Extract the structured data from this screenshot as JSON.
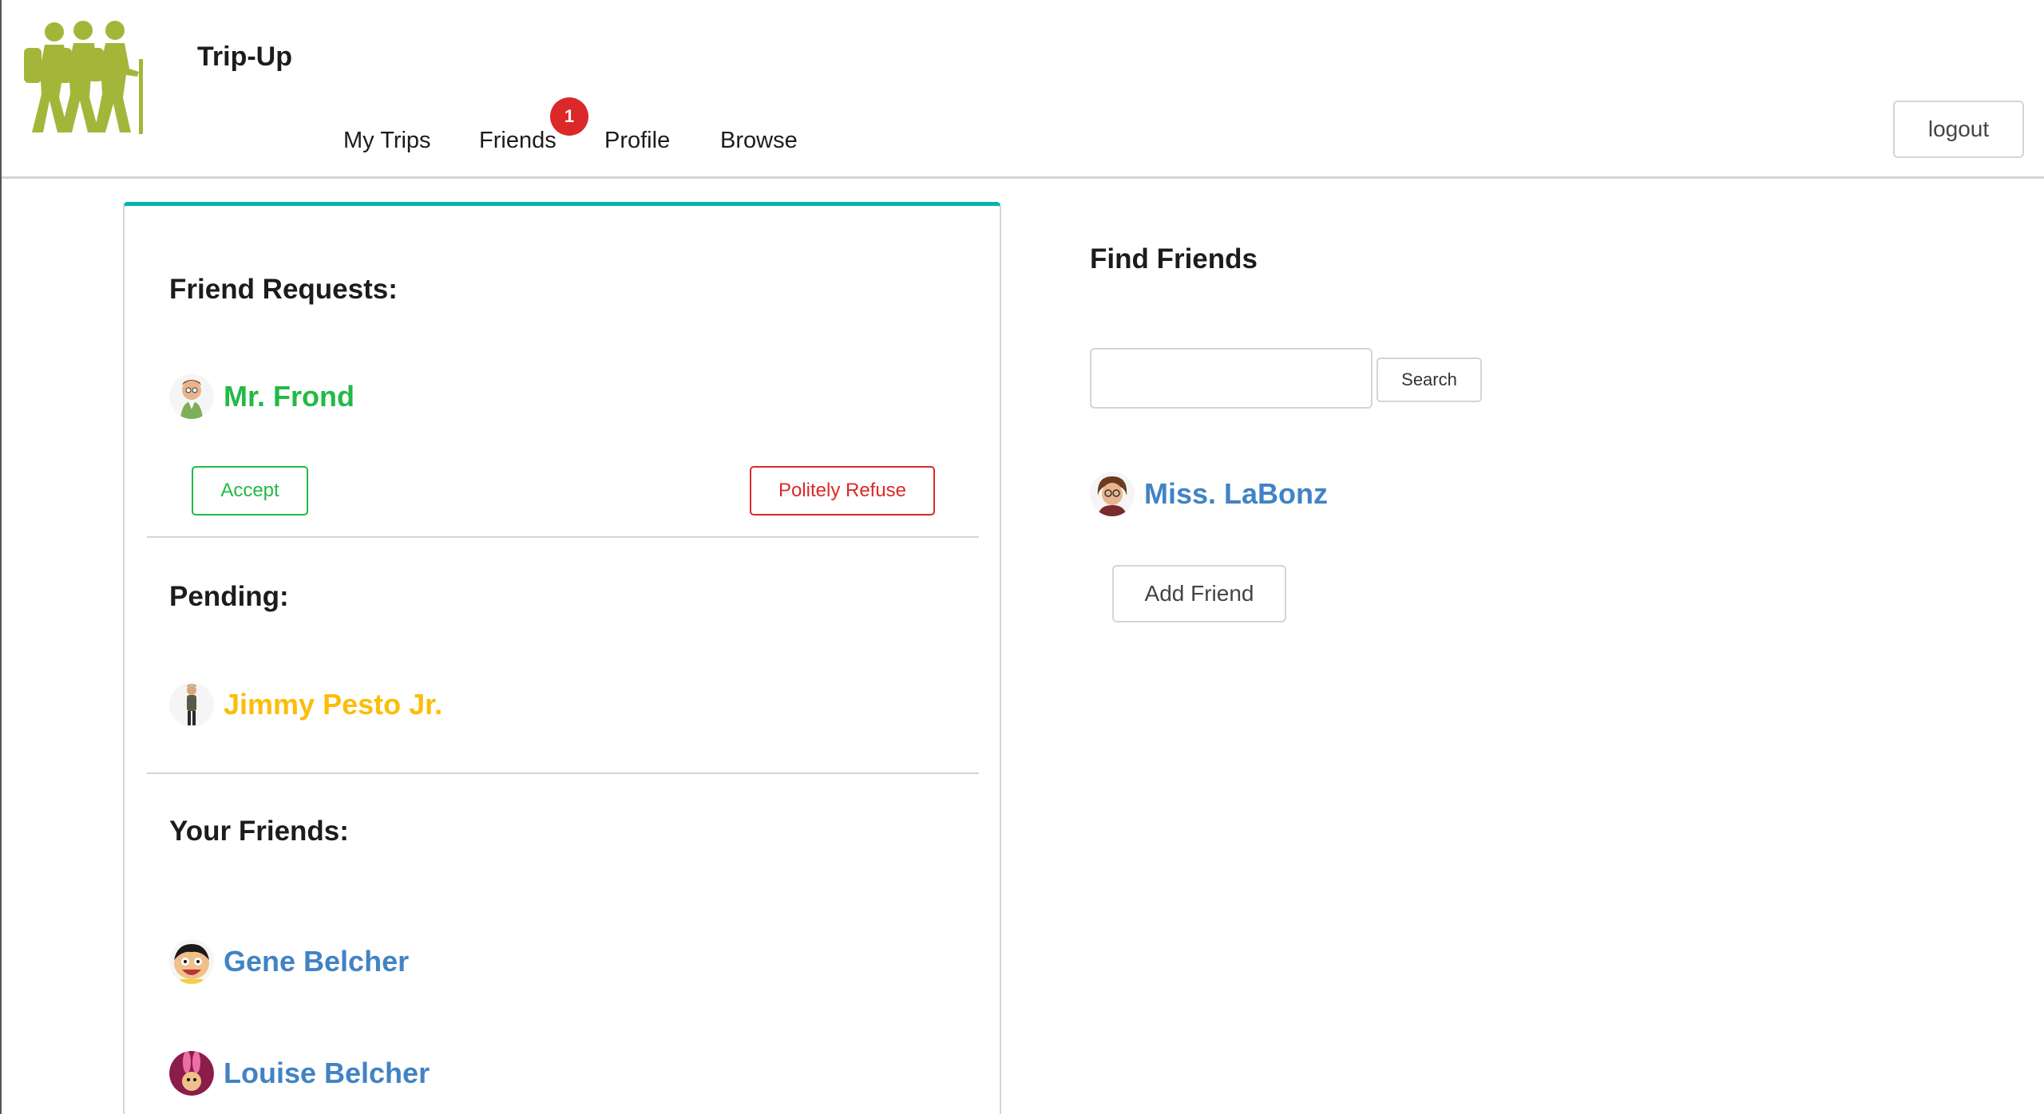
{
  "app": {
    "title": "Trip-Up"
  },
  "nav": {
    "items": [
      {
        "label": "My Trips"
      },
      {
        "label": "Friends",
        "badge": "1"
      },
      {
        "label": "Profile"
      },
      {
        "label": "Browse"
      }
    ],
    "logout_label": "logout"
  },
  "friend_requests": {
    "title": "Friend Requests:",
    "items": [
      {
        "name": "Mr. Frond",
        "avatar": "mr-frond-avatar"
      }
    ],
    "accept_label": "Accept",
    "refuse_label": "Politely Refuse"
  },
  "pending": {
    "title": "Pending:",
    "items": [
      {
        "name": "Jimmy Pesto Jr.",
        "avatar": "jimmy-pesto-jr-avatar"
      }
    ]
  },
  "your_friends": {
    "title": "Your Friends:",
    "items": [
      {
        "name": "Gene Belcher",
        "avatar": "gene-belcher-avatar"
      },
      {
        "name": "Louise Belcher",
        "avatar": "louise-belcher-avatar"
      }
    ]
  },
  "find_friends": {
    "title": "Find Friends",
    "search_value": "",
    "search_button": "Search",
    "results": [
      {
        "name": "Miss. LaBonz",
        "avatar": "miss-labonz-avatar"
      }
    ],
    "add_friend_label": "Add Friend"
  },
  "colors": {
    "accent_teal": "#00b5ad",
    "accept_green": "#21ba45",
    "refuse_red": "#db2828",
    "pending_orange": "#fbbd08",
    "friend_blue": "#4183c4",
    "logo_green": "#a4b63a"
  }
}
